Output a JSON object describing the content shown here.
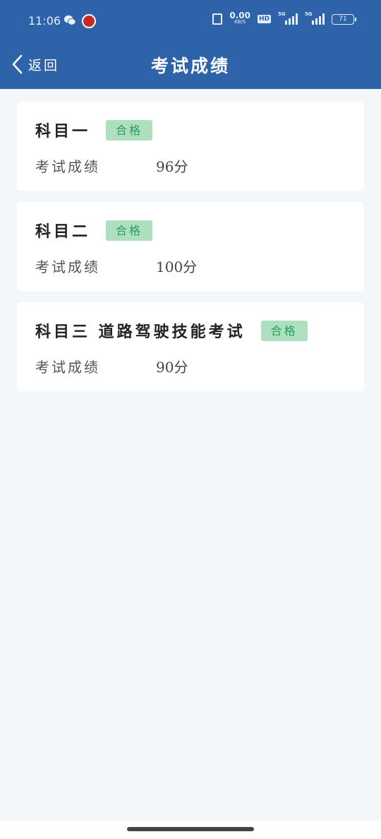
{
  "status_bar": {
    "time": "11:06",
    "net_speed_value": "0.00",
    "net_speed_unit": "KB/S",
    "hd_label": "HD",
    "signal1_label": "5G",
    "signal2_label": "5G",
    "battery": "71"
  },
  "header": {
    "back_label": "返回",
    "title": "考试成绩"
  },
  "results": [
    {
      "subject": "科目一",
      "status": "合格",
      "score_label": "考试成绩",
      "score": "96分"
    },
    {
      "subject": "科目二",
      "status": "合格",
      "score_label": "考试成绩",
      "score": "100分"
    },
    {
      "subject": "科目三 道路驾驶技能考试",
      "status": "合格",
      "score_label": "考试成绩",
      "score": "90分"
    }
  ],
  "colors": {
    "header_bg": "#2e63aa",
    "badge_bg": "#aee0c0",
    "badge_text": "#2e9b59",
    "page_bg": "#f4f7f9"
  }
}
